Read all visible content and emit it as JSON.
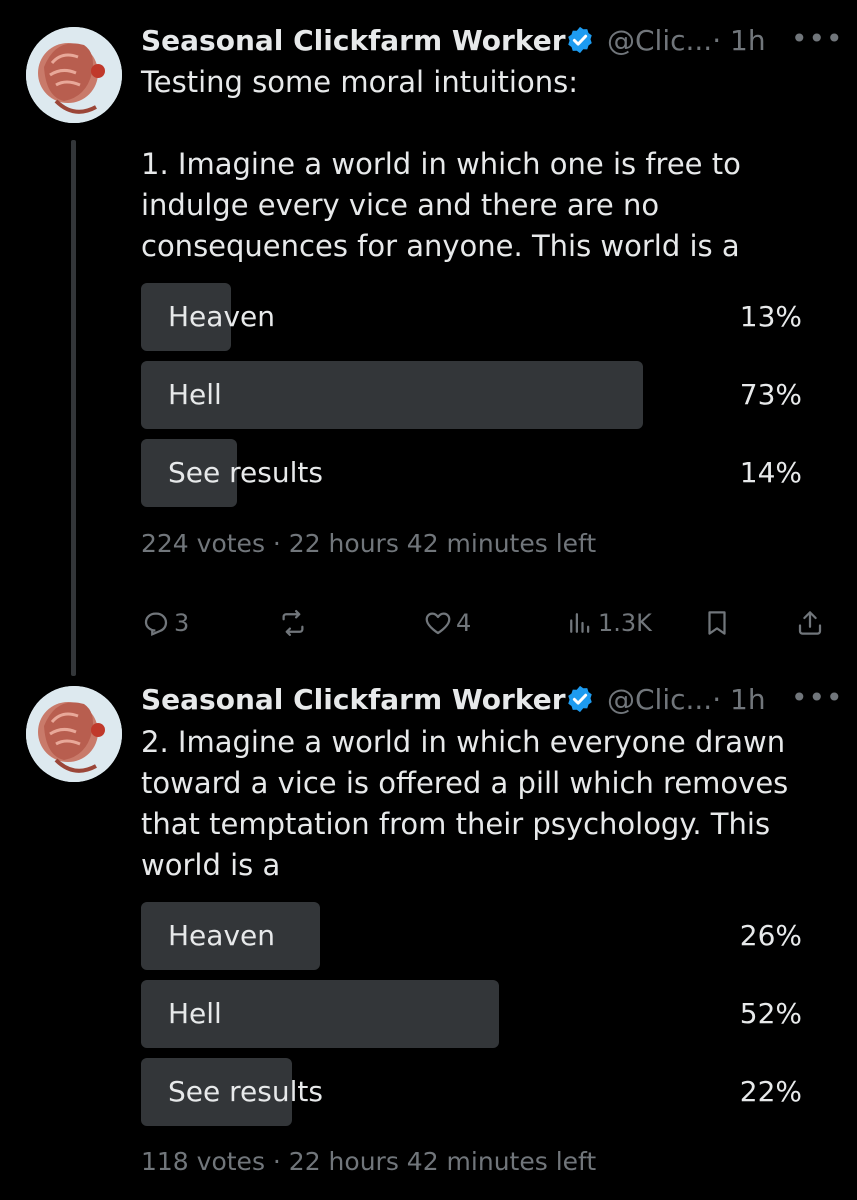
{
  "posts": [
    {
      "author": {
        "name": "Seasonal Clickfarm Worker",
        "handle": "@Clic...",
        "time": "· 1h"
      },
      "text": "Testing some moral intuitions:\n\n1. Imagine a world in which one is free to indulge every vice and there are no consequences for anyone. This world is a",
      "poll": {
        "options": [
          {
            "label": "Heaven",
            "percent_text": "13%",
            "percent": 13
          },
          {
            "label": "Hell",
            "percent_text": "73%",
            "percent": 73
          },
          {
            "label": "See results",
            "percent_text": "14%",
            "percent": 14
          }
        ],
        "summary": "224 votes · 22 hours 42 minutes left"
      },
      "actions": {
        "replies": "3",
        "reposts": "",
        "likes": "4",
        "views": "1.3K"
      }
    },
    {
      "author": {
        "name": "Seasonal Clickfarm Worker",
        "handle": "@Clic...",
        "time": "· 1h"
      },
      "text": "2. Imagine a world in which everyone drawn toward a vice is offered a pill which removes that temptation from their psychology. This world is a",
      "poll": {
        "options": [
          {
            "label": "Heaven",
            "percent_text": "26%",
            "percent": 26
          },
          {
            "label": "Hell",
            "percent_text": "52%",
            "percent": 52
          },
          {
            "label": "See results",
            "percent_text": "22%",
            "percent": 22
          }
        ],
        "summary": "118 votes · 22 hours 42 minutes left"
      }
    }
  ],
  "icons": {
    "more": "more-horizontal-icon",
    "verified": "verified-badge-icon",
    "reply": "reply-icon",
    "repost": "repost-icon",
    "like": "heart-icon",
    "views": "analytics-icon",
    "bookmark": "bookmark-icon",
    "share": "share-icon"
  },
  "colors": {
    "background": "#000000",
    "text": "#e7e9ea",
    "muted": "#71767b",
    "poll_bar": "#333639",
    "verified": "#1d9bf0"
  }
}
